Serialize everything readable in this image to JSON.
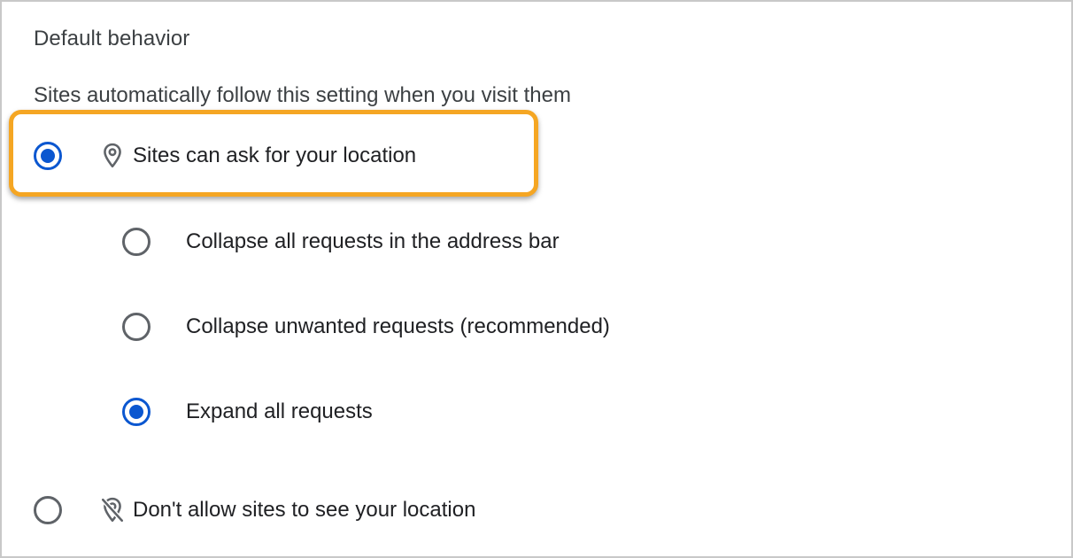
{
  "section": {
    "title": "Default behavior",
    "description": "Sites automatically follow this setting when you visit them"
  },
  "options": {
    "ask": {
      "label": "Sites can ask for your location",
      "icon": "location-pin-icon",
      "selected": true
    },
    "block": {
      "label": "Don't allow sites to see your location",
      "icon": "location-off-icon",
      "selected": false
    }
  },
  "sub_options": {
    "collapse_all": {
      "label": "Collapse all requests in the address bar",
      "selected": false
    },
    "collapse_unwanted": {
      "label": "Collapse unwanted requests (recommended)",
      "selected": false
    },
    "expand_all": {
      "label": "Expand all requests",
      "selected": true
    }
  },
  "colors": {
    "accent": "#0b57d0",
    "highlight": "#f5a623",
    "radio_unselected": "#5f6368",
    "text": "#202124"
  }
}
